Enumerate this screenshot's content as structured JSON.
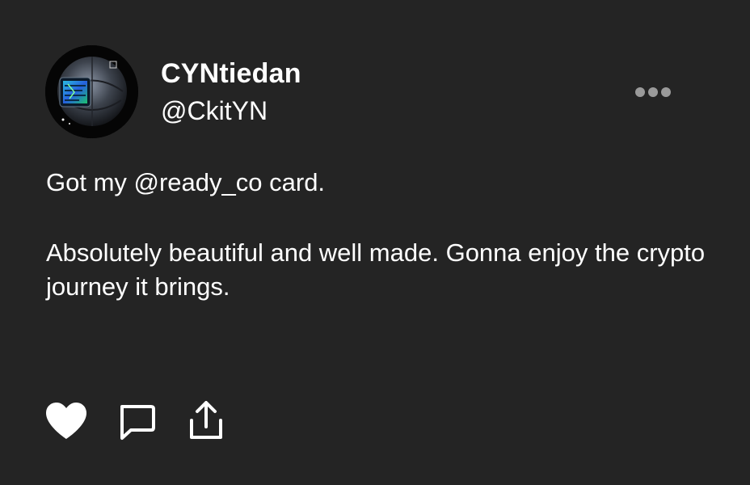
{
  "user": {
    "display_name": "CYNtiedan",
    "handle": "@CkitYN",
    "avatar": "orb-avatar"
  },
  "header": {
    "more_icon": "more-horizontal-icon"
  },
  "tweet": {
    "paragraphs": [
      "Got my @ready_co card.",
      "Absolutely beautiful and well made. Gonna enjoy the crypto journey it brings."
    ]
  },
  "actions": [
    {
      "icon": "heart-icon"
    },
    {
      "icon": "comment-icon"
    },
    {
      "icon": "share-icon"
    }
  ],
  "colors": {
    "background": "#242424",
    "text": "#ffffff",
    "muted": "#9a9a9a"
  }
}
